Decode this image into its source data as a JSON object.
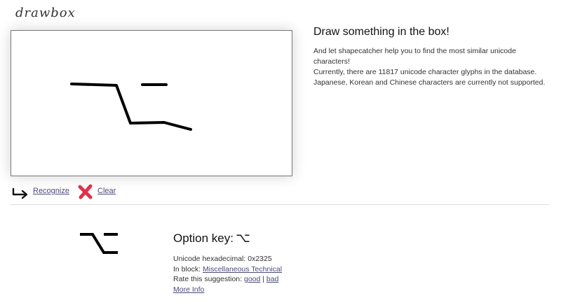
{
  "app": {
    "logo": "drawbox"
  },
  "controls": {
    "recognize_label": "Recognize",
    "clear_label": "Clear"
  },
  "info": {
    "title": "Draw something in the box!",
    "line1": "And let shapecatcher help you to find the most similar unicode characters!",
    "line2": "Currently, there are 11817 unicode character glyphs in the database.",
    "line3": "Japanese, Korean and Chinese characters are currently not supported."
  },
  "result": {
    "name": "Option key:",
    "symbol": "⌥",
    "hex_label": "Unicode hexadecimal: 0x2325",
    "block_prefix": "In block: ",
    "block_name": "Miscellaneous Technical",
    "rate_prefix": "Rate this suggestion: ",
    "rate_good": "good",
    "rate_sep": " | ",
    "rate_bad": "bad",
    "more_info": "More Info"
  },
  "colors": {
    "link": "#4a4a7a",
    "clear_icon": "#e0304a",
    "stroke": "#000000"
  },
  "icons": {
    "recognize": "return-arrow-icon",
    "clear": "red-x-icon"
  }
}
